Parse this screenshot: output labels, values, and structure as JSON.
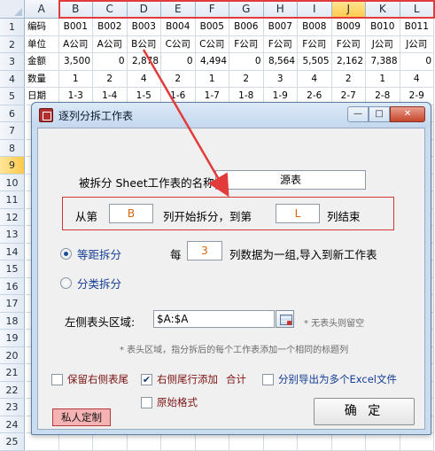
{
  "sheet": {
    "columns": [
      "A",
      "B",
      "C",
      "D",
      "E",
      "F",
      "G",
      "H",
      "I",
      "J",
      "K",
      "L"
    ],
    "selected_column": "J",
    "row_numbers": [
      "1",
      "2",
      "3",
      "4",
      "5",
      "6",
      "7",
      "8",
      "9",
      "10",
      "11",
      "12",
      "13",
      "14",
      "15",
      "16",
      "17",
      "18",
      "19",
      "20",
      "21",
      "22",
      "23",
      "24",
      "25"
    ],
    "selected_row": "9",
    "rows": [
      [
        "编码",
        "B001",
        "B002",
        "B003",
        "B004",
        "B005",
        "B006",
        "B007",
        "B008",
        "B009",
        "B010",
        "B011"
      ],
      [
        "单位",
        "A公司",
        "A公司",
        "B公司",
        "C公司",
        "C公司",
        "F公司",
        "F公司",
        "F公司",
        "F公司",
        "J公司",
        "J公司"
      ],
      [
        "金额",
        "3,500",
        "0",
        "2,878",
        "0",
        "4,494",
        "0",
        "8,564",
        "5,505",
        "2,162",
        "7,388",
        "0"
      ],
      [
        "数量",
        "1",
        "2",
        "4",
        "2",
        "1",
        "2",
        "3",
        "4",
        "2",
        "1",
        "4"
      ],
      [
        "日期",
        "1-3",
        "1-4",
        "1-5",
        "1-6",
        "1-7",
        "1-8",
        "1-9",
        "2-6",
        "2-7",
        "2-8",
        "2-9"
      ]
    ]
  },
  "dialog": {
    "title": "逐列分拆工作表",
    "window_buttons": {
      "minimize": "—",
      "maximize": "□",
      "close": "✕"
    },
    "sheet_name_label": "被拆分 Sheet工作表的名称:",
    "sheet_name_value": "源表",
    "range": {
      "from_label": "从第",
      "from_value": "B",
      "middle_label": "列开始拆分，到第",
      "to_value": "L",
      "end_label": "列结束"
    },
    "equal_split": {
      "label": "等距拆分",
      "selected": true,
      "every_label": "每",
      "every_value": "3",
      "group_label": "列数据为一组,导入到新工作表"
    },
    "category_split": {
      "label": "分类拆分",
      "selected": false
    },
    "header_area": {
      "label": "左侧表头区域:",
      "value": "$A:$A",
      "hint_no_header": "* 无表头则留空",
      "hint_header": "* 表头区域，指分拆后的每个工作表添加一个相同的标题列"
    },
    "options": {
      "keep_right_tail": {
        "label": "保留右侧表尾",
        "checked": false
      },
      "add_total_row": {
        "label": "右侧尾行添加",
        "suffix": "合计",
        "checked": true
      },
      "export_excel": {
        "label": "分别导出为多个Excel文件",
        "checked": false
      },
      "original_format": {
        "label": "原始格式",
        "checked": false
      }
    },
    "custom_button": "私人定制",
    "ok_button": "确 定"
  },
  "colors": {
    "annotation_red": "#e23b3b",
    "header_selected": "#ffc94a",
    "dialog_frame": "#c9ddf1",
    "link_blue": "#123c93",
    "range_orange": "#d6650b"
  }
}
